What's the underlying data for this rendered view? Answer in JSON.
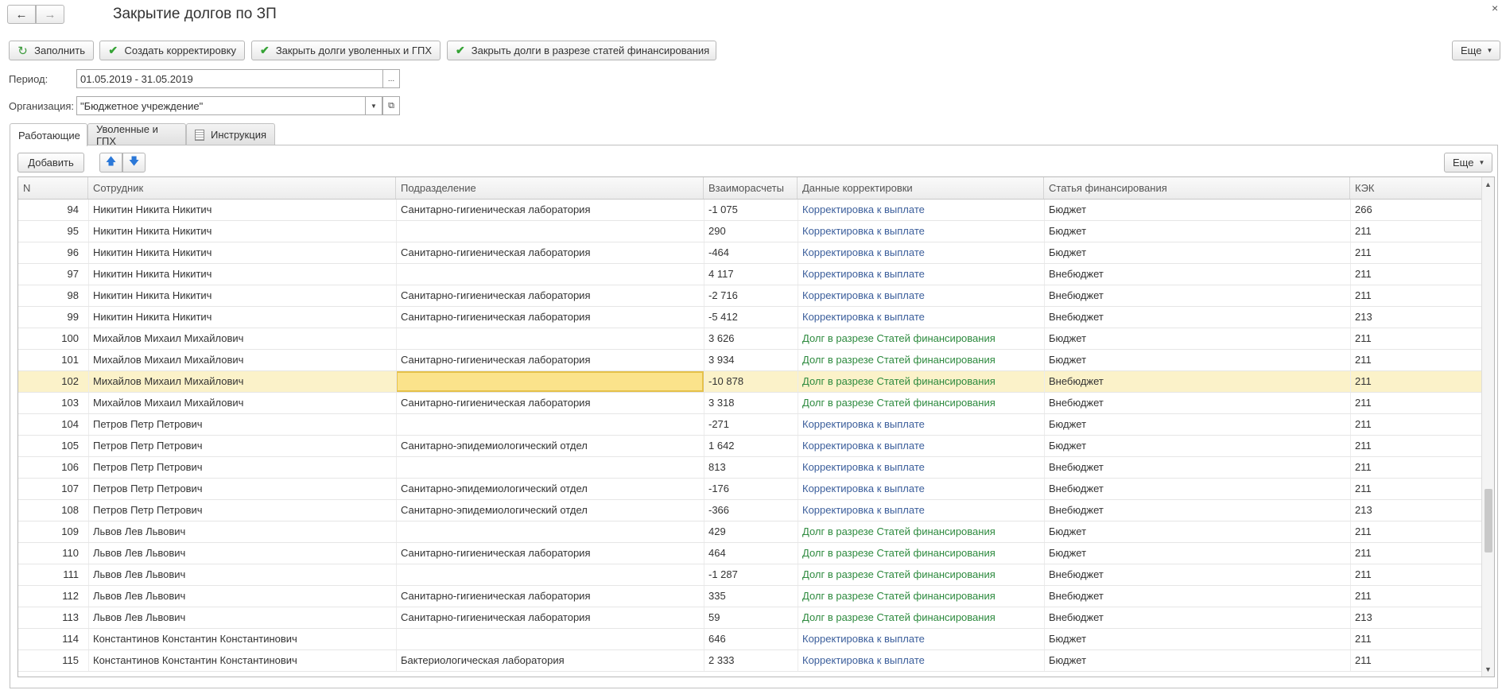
{
  "window": {
    "title": "Закрытие долгов по ЗП",
    "close_icon": "close-icon"
  },
  "nav": {
    "back_icon": "←",
    "forward_icon": "→"
  },
  "toolbar": {
    "fill": "Заполнить",
    "create_correction": "Создать корректировку",
    "close_fired": "Закрыть долги уволенных и ГПХ",
    "close_by_items": "Закрыть долги в разрезе статей финансирования",
    "more": "Еще"
  },
  "form": {
    "period_label": "Период:",
    "period_value": "01.05.2019 - 31.05.2019",
    "org_label": "Организация:",
    "org_value": "\"Бюджетное учреждение\"",
    "ellipsis": "..."
  },
  "tabs": [
    {
      "label": "Работающие",
      "active": true
    },
    {
      "label": "Уволенные и ГПХ"
    },
    {
      "label": "Инструкция"
    }
  ],
  "grid_toolbar": {
    "add": "Добавить",
    "more": "Еще"
  },
  "table": {
    "columns": [
      "N",
      "Сотрудник",
      "Подразделение",
      "Взаиморасчеты",
      "Данные корректировки",
      "Статья финансирования",
      "КЭК"
    ],
    "rows": [
      [
        "94",
        "Никитин Никита Никитич",
        "Санитарно-гигиеническая лаборатория",
        "-1 075",
        "Корректировка к выплате",
        "Бюджет",
        "266"
      ],
      [
        "95",
        "Никитин Никита Никитич",
        "",
        "290",
        "Корректировка к выплате",
        "Бюджет",
        "211"
      ],
      [
        "96",
        "Никитин Никита Никитич",
        "Санитарно-гигиеническая лаборатория",
        "-464",
        "Корректировка к выплате",
        "Бюджет",
        "211"
      ],
      [
        "97",
        "Никитин Никита Никитич",
        "",
        "4 117",
        "Корректировка к выплате",
        "Внебюджет",
        "211"
      ],
      [
        "98",
        "Никитин Никита Никитич",
        "Санитарно-гигиеническая лаборатория",
        "-2 716",
        "Корректировка к выплате",
        "Внебюджет",
        "211"
      ],
      [
        "99",
        "Никитин Никита Никитич",
        "Санитарно-гигиеническая лаборатория",
        "-5 412",
        "Корректировка к выплате",
        "Внебюджет",
        "213"
      ],
      [
        "100",
        "Михайлов Михаил Михайлович",
        "",
        "3 626",
        "Долг в разрезе Статей финансирования",
        "Бюджет",
        "211"
      ],
      [
        "101",
        "Михайлов Михаил Михайлович",
        "Санитарно-гигиеническая лаборатория",
        "3 934",
        "Долг в разрезе Статей финансирования",
        "Бюджет",
        "211"
      ],
      [
        "102",
        "Михайлов Михаил Михайлович",
        "",
        "-10 878",
        "Долг в разрезе Статей финансирования",
        "Внебюджет",
        "211"
      ],
      [
        "103",
        "Михайлов Михаил Михайлович",
        "Санитарно-гигиеническая лаборатория",
        "3 318",
        "Долг в разрезе Статей финансирования",
        "Внебюджет",
        "211"
      ],
      [
        "104",
        "Петров Петр Петрович",
        "",
        "-271",
        "Корректировка к выплате",
        "Бюджет",
        "211"
      ],
      [
        "105",
        "Петров Петр Петрович",
        "Санитарно-эпидемиологический отдел",
        "1 642",
        "Корректировка к выплате",
        "Бюджет",
        "211"
      ],
      [
        "106",
        "Петров Петр Петрович",
        "",
        "813",
        "Корректировка к выплате",
        "Внебюджет",
        "211"
      ],
      [
        "107",
        "Петров Петр Петрович",
        "Санитарно-эпидемиологический отдел",
        "-176",
        "Корректировка к выплате",
        "Внебюджет",
        "211"
      ],
      [
        "108",
        "Петров Петр Петрович",
        "Санитарно-эпидемиологический отдел",
        "-366",
        "Корректировка к выплате",
        "Внебюджет",
        "213"
      ],
      [
        "109",
        "Львов Лев Львович",
        "",
        "429",
        "Долг в разрезе Статей финансирования",
        "Бюджет",
        "211"
      ],
      [
        "110",
        "Львов Лев Львович",
        "Санитарно-гигиеническая лаборатория",
        "464",
        "Долг в разрезе Статей финансирования",
        "Бюджет",
        "211"
      ],
      [
        "111",
        "Львов Лев Львович",
        "",
        "-1 287",
        "Долг в разрезе Статей финансирования",
        "Внебюджет",
        "211"
      ],
      [
        "112",
        "Львов Лев Львович",
        "Санитарно-гигиеническая лаборатория",
        "335",
        "Долг в разрезе Статей финансирования",
        "Внебюджет",
        "211"
      ],
      [
        "113",
        "Львов Лев Львович",
        "Санитарно-гигиеническая лаборатория",
        "59",
        "Долг в разрезе Статей финансирования",
        "Внебюджет",
        "213"
      ],
      [
        "114",
        "Константинов Константин Константинович",
        "",
        "646",
        "Корректировка к выплате",
        "Бюджет",
        "211"
      ],
      [
        "115",
        "Константинов Константин Константинович",
        "Бактериологическая лаборатория",
        "2 333",
        "Корректировка к выплате",
        "Бюджет",
        "211"
      ]
    ],
    "selected_row_n": "102"
  },
  "colors": {
    "link": "#3b5e9b",
    "green_link": "#2d8a3e",
    "selected_row": "#fbf2c9",
    "focus_cell": "#fbe38b"
  }
}
